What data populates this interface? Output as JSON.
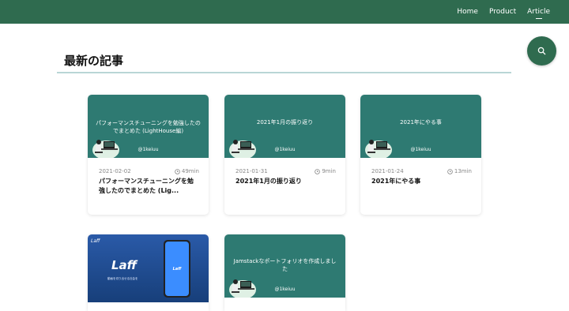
{
  "nav": {
    "items": [
      "Home",
      "Product",
      "Article"
    ],
    "active_index": 2
  },
  "search": {
    "icon": "search-icon"
  },
  "page": {
    "title": "最新の記事"
  },
  "articles": [
    {
      "thumb_title": "パフォーマンスチューニングを勉強したのでまとめた (LightHouse編)",
      "handle": "@1keiuu",
      "date": "2021-02-02",
      "read_time": "49min",
      "title": "パフォーマンスチューニングを勉強したのでまとめた (Lig..."
    },
    {
      "thumb_title": "2021年1月の振り返り",
      "handle": "@1keiuu",
      "date": "2021-01-31",
      "read_time": "9min",
      "title": "2021年1月の振り返り"
    },
    {
      "thumb_title": "2021年にやる事",
      "handle": "@1keiuu",
      "date": "2021-01-24",
      "read_time": "13min",
      "title": "2021年にやる事"
    },
    {
      "thumb_brand": "Laff",
      "thumb_caption": "動画を切り出せる社会を"
    },
    {
      "thumb_title": "Jamstackなポートフォリオを作成しました",
      "handle": "@1keiuu"
    }
  ],
  "colors": {
    "header": "#2f6b4f",
    "thumb": "#2e7a72",
    "laff_blue": "#2a5aa8"
  }
}
